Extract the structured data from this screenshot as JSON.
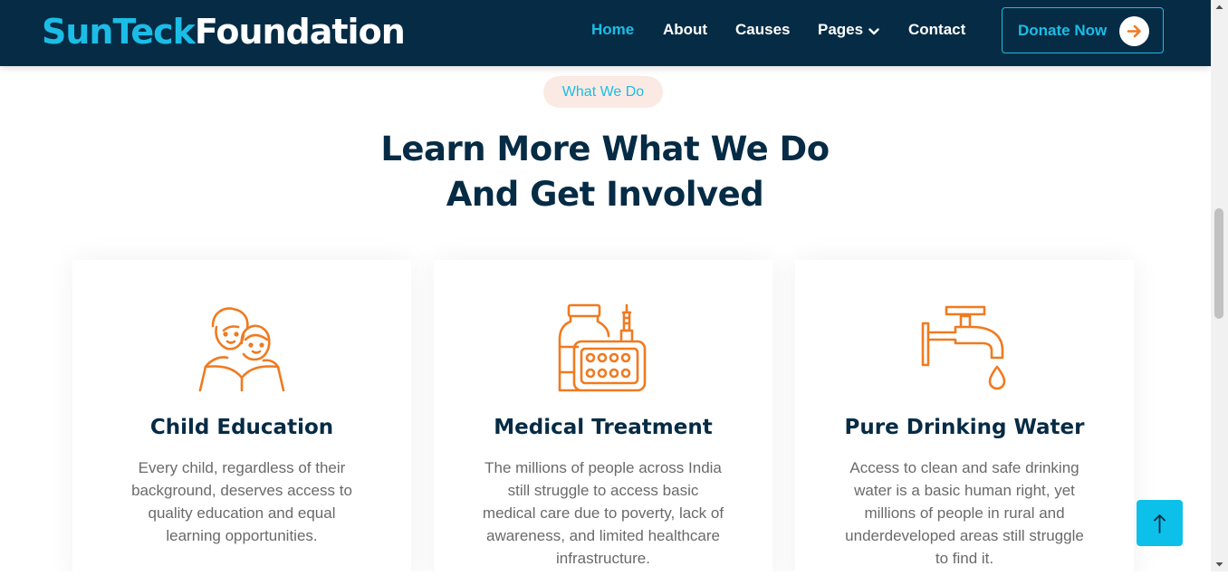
{
  "header": {
    "logo_part1": "SunTeck",
    "logo_part2": "Foundation",
    "nav": [
      {
        "label": "Home"
      },
      {
        "label": "About"
      },
      {
        "label": "Causes"
      },
      {
        "label": "Pages"
      },
      {
        "label": "Contact"
      }
    ],
    "donate_label": "Donate Now"
  },
  "section": {
    "tag": "What We Do",
    "heading_line1": "Learn More What We Do",
    "heading_line2": "And Get Involved"
  },
  "cards": [
    {
      "icon": "children-reading-icon",
      "title": "Child Education",
      "text": "Every child, regardless of their background, deserves access to quality education and equal learning opportunities."
    },
    {
      "icon": "medicine-icon",
      "title": "Medical Treatment",
      "text": "The millions of people across India still struggle to access basic medical care due to poverty, lack of awareness, and limited healthcare infrastructure."
    },
    {
      "icon": "water-tap-icon",
      "title": "Pure Drinking Water",
      "text": "Access to clean and safe drinking water is a basic human right, yet millions of people in rural and underdeveloped areas still struggle to find it."
    }
  ],
  "colors": {
    "navy": "#062b45",
    "accent": "#1bbde6",
    "icon_orange": "#f07a1f",
    "pill_bg": "#fbeae3"
  }
}
